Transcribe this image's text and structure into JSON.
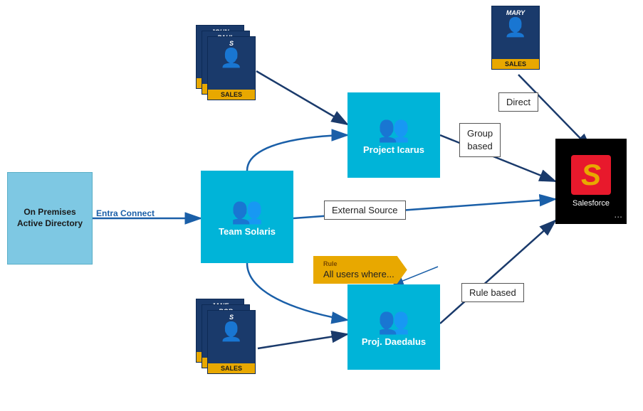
{
  "ad_box": {
    "label": "On Premises Active Directory"
  },
  "entra_connect": {
    "label": "Entra Connect"
  },
  "stacks": {
    "top": {
      "cards": [
        {
          "name": "JOHN",
          "badge": "SALES"
        },
        {
          "name": "PAUL",
          "badge": "SALES"
        },
        {
          "name": "S",
          "badge": "SALES"
        }
      ]
    },
    "bottom": {
      "cards": [
        {
          "name": "JANE",
          "badge": "SALES"
        },
        {
          "name": "BOB",
          "badge": "SALES"
        },
        {
          "name": "S",
          "badge": "SALES"
        }
      ]
    }
  },
  "mary_card": {
    "name": "MARY",
    "badge": "SALES"
  },
  "groups": {
    "icarus": {
      "label": "Project Icarus"
    },
    "solaris": {
      "label": "Team Solaris"
    },
    "daedalus": {
      "label": "Proj. Daedalus"
    }
  },
  "salesforce": {
    "logo": "S",
    "label": "Salesforce",
    "dots": "..."
  },
  "labels": {
    "direct": "Direct",
    "group_based": "Group\nbased",
    "external_source": "External Source",
    "rule_based": "Rule based",
    "rule_banner": "All users where...",
    "rule_tag": "Rule"
  },
  "colors": {
    "blue_dark": "#1a3a6b",
    "blue_mid": "#1a5fa8",
    "cyan": "#00B4D8",
    "ad_blue": "#7EC8E3",
    "gold": "#E8A800",
    "salesforce_red": "#E8192C"
  }
}
